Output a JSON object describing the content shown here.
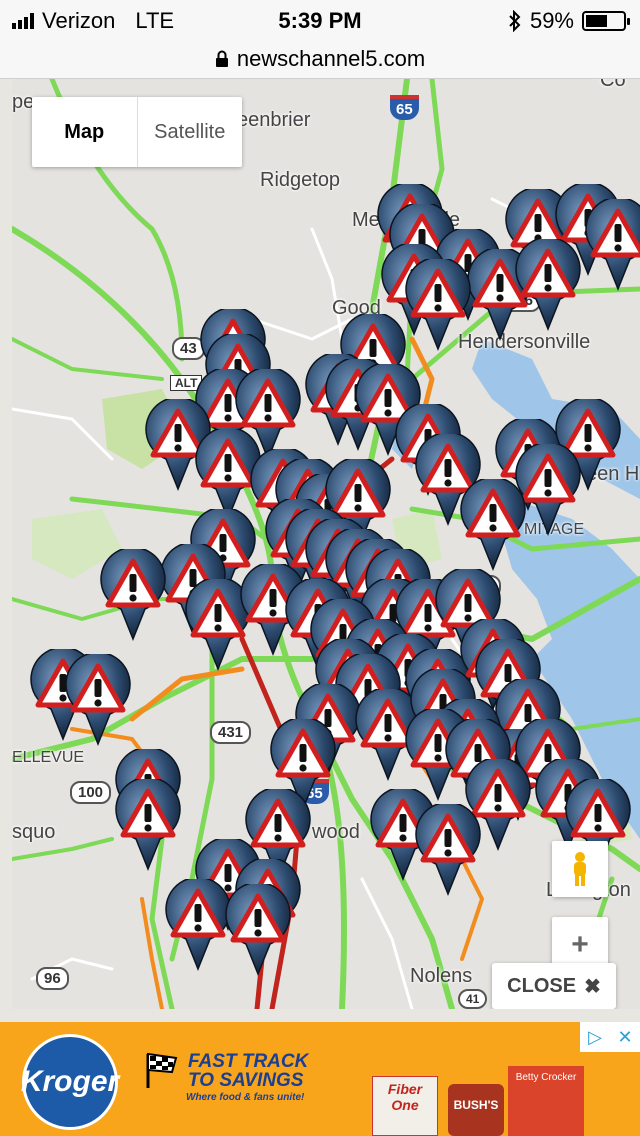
{
  "status_bar": {
    "carrier": "Verizon",
    "network": "LTE",
    "time": "5:39 PM",
    "battery_percent": "59%",
    "battery_level": 0.59,
    "icons": [
      "signal-icon",
      "bluetooth-icon",
      "battery-icon"
    ]
  },
  "browser": {
    "url": "newschannel5.com",
    "lock_icon": "lock-icon"
  },
  "map": {
    "type_control": {
      "map_label": "Map",
      "satellite_label": "Satellite",
      "selected": "Map"
    },
    "places": {
      "greenbrier": "eenbrier",
      "ridgetop": "Ridgetop",
      "millersville": "Me",
      "millersville_tail": "lle",
      "goodlettsville": "Good",
      "goodlettsville_tail": "lle",
      "hendersonville": "Hendersonville",
      "green_hills": "een H",
      "hermitage": "MITAGE",
      "bellevue": "ELLEVUE",
      "pasquo": "squo",
      "brentwood": "wood",
      "oak_hill": "C",
      "oak_hill_tail": "ll",
      "nolensville": "Nolens",
      "lebanon": "L",
      "lebanon_tail": "gton",
      "pleasant_view": "pe",
      "corner": "Co"
    },
    "shields": {
      "i65_north": "65",
      "i65_south": "65",
      "us431": "431",
      "us70": "70",
      "sr100": "100",
      "sr96": "96",
      "rt386": "386",
      "rt43": "43",
      "alt": "ALT",
      "rt41": "41"
    },
    "marker_icon": "traffic-warning-marker-icon",
    "controls": {
      "pegman_icon": "pegman-icon",
      "zoom_in_label": "+",
      "close_label": "CLOSE"
    },
    "colors": {
      "free_flow": "#7ed957",
      "slow": "#f28c1e",
      "congested": "#c0241c",
      "water": "#9fc5e8",
      "park": "#c8e1a5"
    }
  },
  "ad": {
    "brand": "Kroger",
    "headline_line1": "FAST TRACK",
    "headline_line2": "TO SAVINGS",
    "tagline": "Where food & fans unite!",
    "products": [
      "Fiber One",
      "BUSH'S",
      "Betty Crocker"
    ],
    "adchoices_icon": "adchoices-icon",
    "close_icon": "close-icon",
    "brand_color": "#1d5aa8",
    "background": "#f8a51c"
  }
}
